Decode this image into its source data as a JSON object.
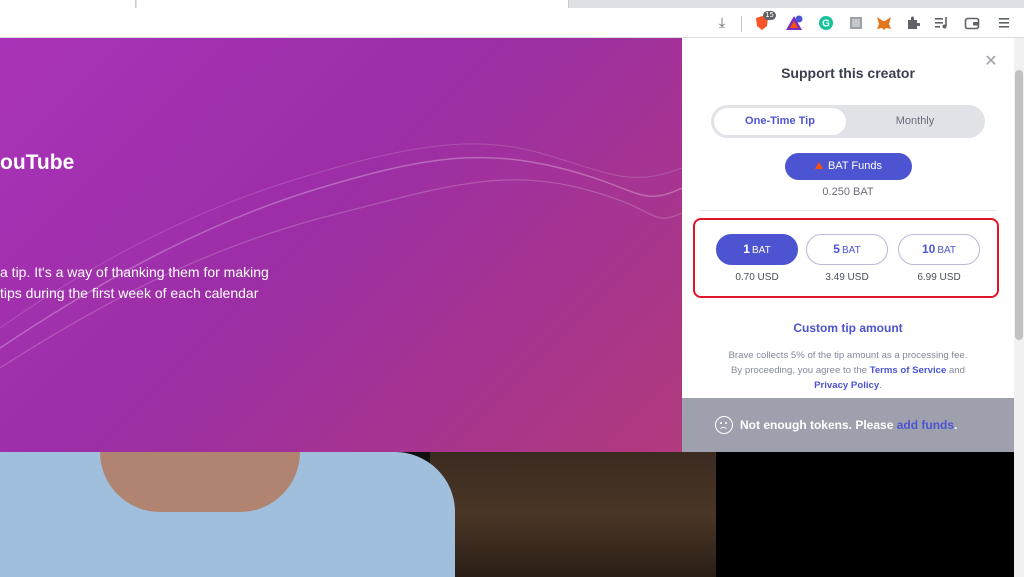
{
  "browser": {
    "toolbar_icons": [
      "download-icon",
      "brave-shield-icon",
      "brave-rewards-icon",
      "grammarly-icon",
      "extension-icon",
      "metamask-icon",
      "puzzle-icon",
      "media-icon",
      "wallet-icon",
      "menu-icon"
    ],
    "shield_badge": "15"
  },
  "hero": {
    "title": "ouTube",
    "line1": "a tip. It's a way of thanking them for making",
    "line2": "tips during the first week of each calendar"
  },
  "panel": {
    "title": "Support this creator",
    "tabs": {
      "one_time": "One-Time Tip",
      "monthly": "Monthly"
    },
    "funds_button": "BAT Funds",
    "balance": "0.250 BAT",
    "amounts": [
      {
        "value": "1",
        "unit": "BAT",
        "usd": "0.70 USD",
        "selected": true
      },
      {
        "value": "5",
        "unit": "BAT",
        "usd": "3.49 USD",
        "selected": false
      },
      {
        "value": "10",
        "unit": "BAT",
        "usd": "6.99 USD",
        "selected": false
      }
    ],
    "custom_tip": "Custom tip amount",
    "fee": {
      "line1": "Brave collects 5% of the tip amount as a processing fee.",
      "line2_prefix": "By proceeding, you agree to the ",
      "terms": "Terms of Service",
      "and": " and",
      "privacy": "Privacy Policy",
      "period": "."
    },
    "footer": {
      "message": "Not enough tokens. Please ",
      "add_funds": "add funds",
      "period": "."
    }
  },
  "colors": {
    "accent": "#4c54d2",
    "highlight": "#e0152b",
    "hero_start": "#a933b8",
    "hero_end": "#b03a7c",
    "footer": "#9ea1ad"
  }
}
